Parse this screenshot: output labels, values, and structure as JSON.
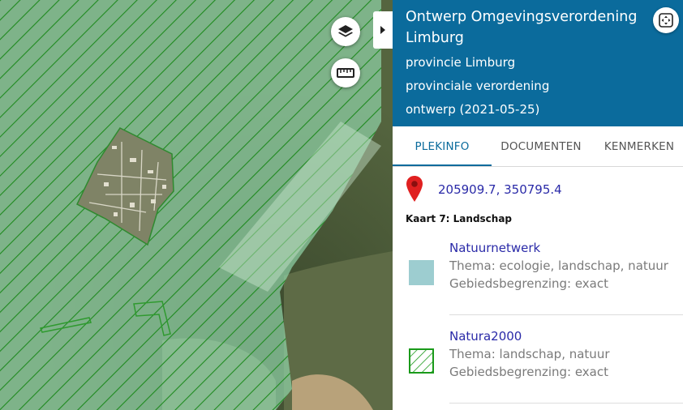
{
  "header": {
    "title": "Ontwerp Omgevingsverordening Limburg",
    "authority": "provincie Limburg",
    "document_type": "provinciale verordening",
    "status": "ontwerp (2021-05-25)"
  },
  "tabs": [
    {
      "label": "PLEKINFO",
      "active": true
    },
    {
      "label": "DOCUMENTEN",
      "active": false
    },
    {
      "label": "KENMERKEN",
      "active": false
    }
  ],
  "location": {
    "icon": "map-pin-icon",
    "coordinates": "205909.7, 350795.4"
  },
  "map_section": {
    "label": "Kaart 7: Landschap"
  },
  "legend_items": [
    {
      "title": "Natuurnetwerk",
      "thema": "Thema: ecologie, landschap, natuur",
      "begrenzing": "Gebiedsbegrenzing: exact",
      "swatch_color": "#9dcdd0"
    },
    {
      "title": "Natura2000",
      "thema": "Thema: landschap, natuur",
      "begrenzing": "Gebiedsbegrenzing: exact",
      "swatch_color": "#1a9a1a"
    }
  ],
  "map_controls": {
    "layers_icon": "layers-icon",
    "measure_icon": "ruler-icon",
    "collapse_icon": "caret-right-icon",
    "fullscreen_icon": "fullscreen-icon"
  },
  "colors": {
    "header_bg": "#0b6b9c",
    "link": "#2a2aa8",
    "hatch": "#1f8a1f",
    "overlay": "#8fd1a6"
  }
}
